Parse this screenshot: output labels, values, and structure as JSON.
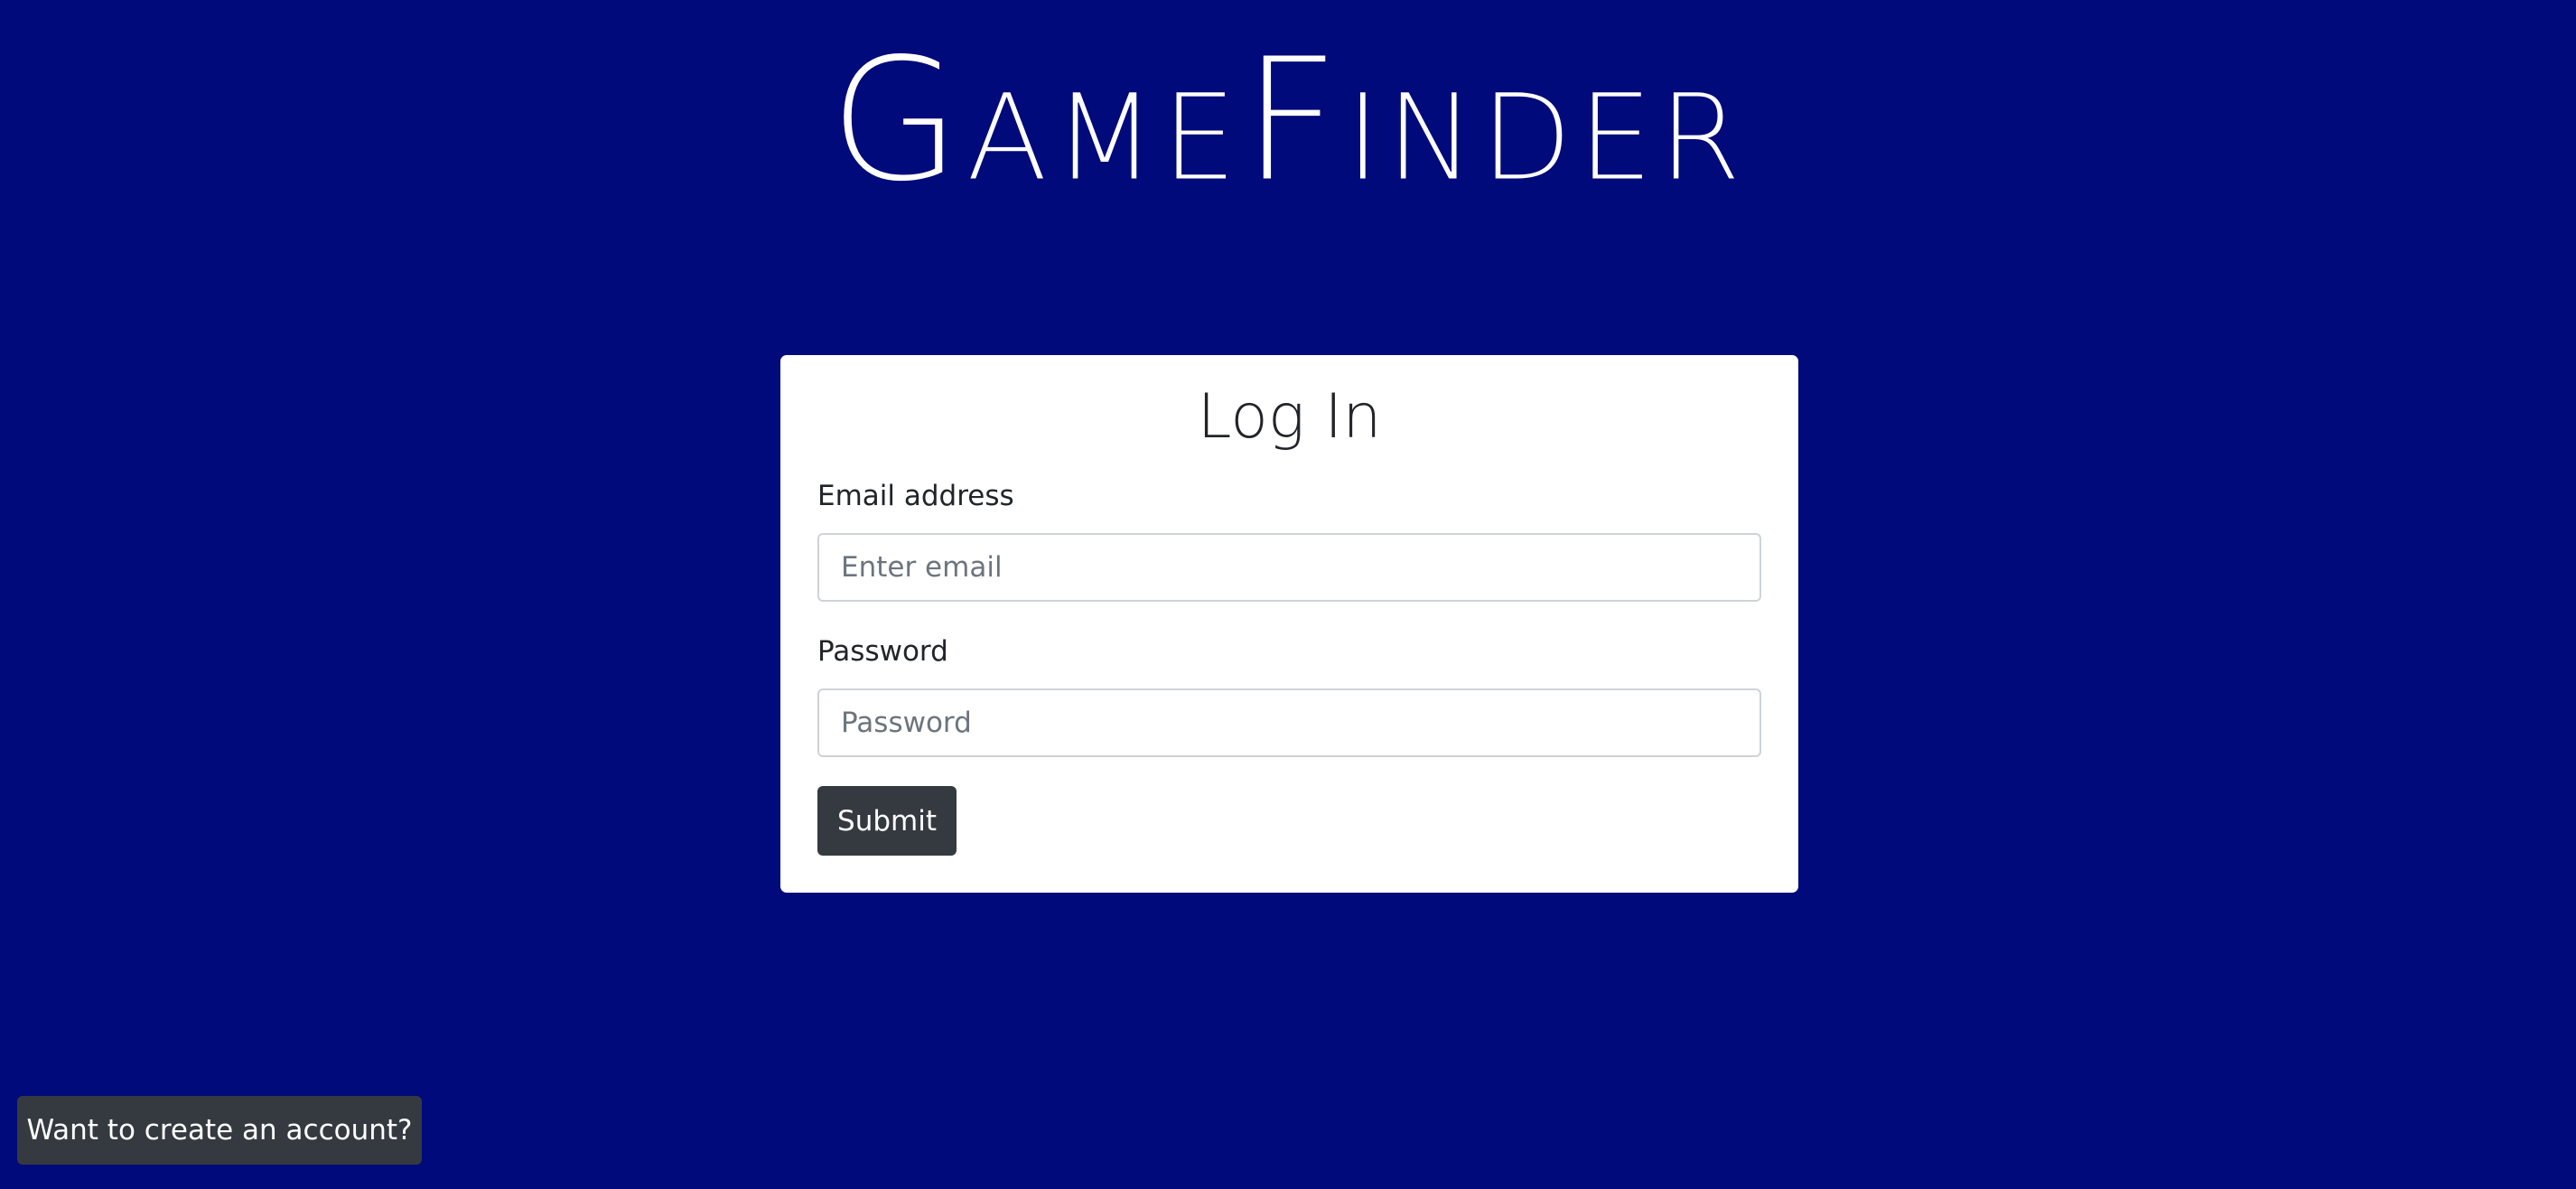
{
  "brand": {
    "logo_text": "GameFinder"
  },
  "login_card": {
    "title": "Log In",
    "email_label": "Email address",
    "email_placeholder": "Enter email",
    "email_value": "",
    "password_label": "Password",
    "password_placeholder": "Password",
    "password_value": "",
    "submit_label": "Submit"
  },
  "footer": {
    "create_account_label": "Want to create an account?"
  },
  "colors": {
    "background": "#000a7a",
    "card": "#ffffff",
    "button_dark": "#343a40"
  }
}
